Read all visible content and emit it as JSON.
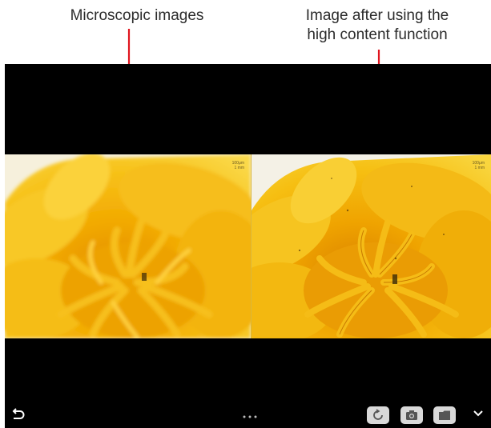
{
  "annotations": {
    "left_caption": "Microscopic images",
    "right_caption_line1": "Image after using the",
    "right_caption_line2": "high content function"
  },
  "panes": {
    "left": {
      "scale_line1": "100μm",
      "scale_line2": "1 mm"
    },
    "right": {
      "scale_line1": "100μm",
      "scale_line2": "1 mm"
    }
  },
  "toolbar": {
    "back_icon": "back-arrow-icon",
    "page_indicator_icon": "page-dots-icon",
    "buttons": [
      "rotate-icon",
      "camera-icon",
      "folder-icon"
    ],
    "collapse_icon": "chevron-down-icon"
  },
  "colors": {
    "arrow": "#e0141e",
    "screen_bg": "#000000",
    "button_bg": "#d9d9d9"
  }
}
